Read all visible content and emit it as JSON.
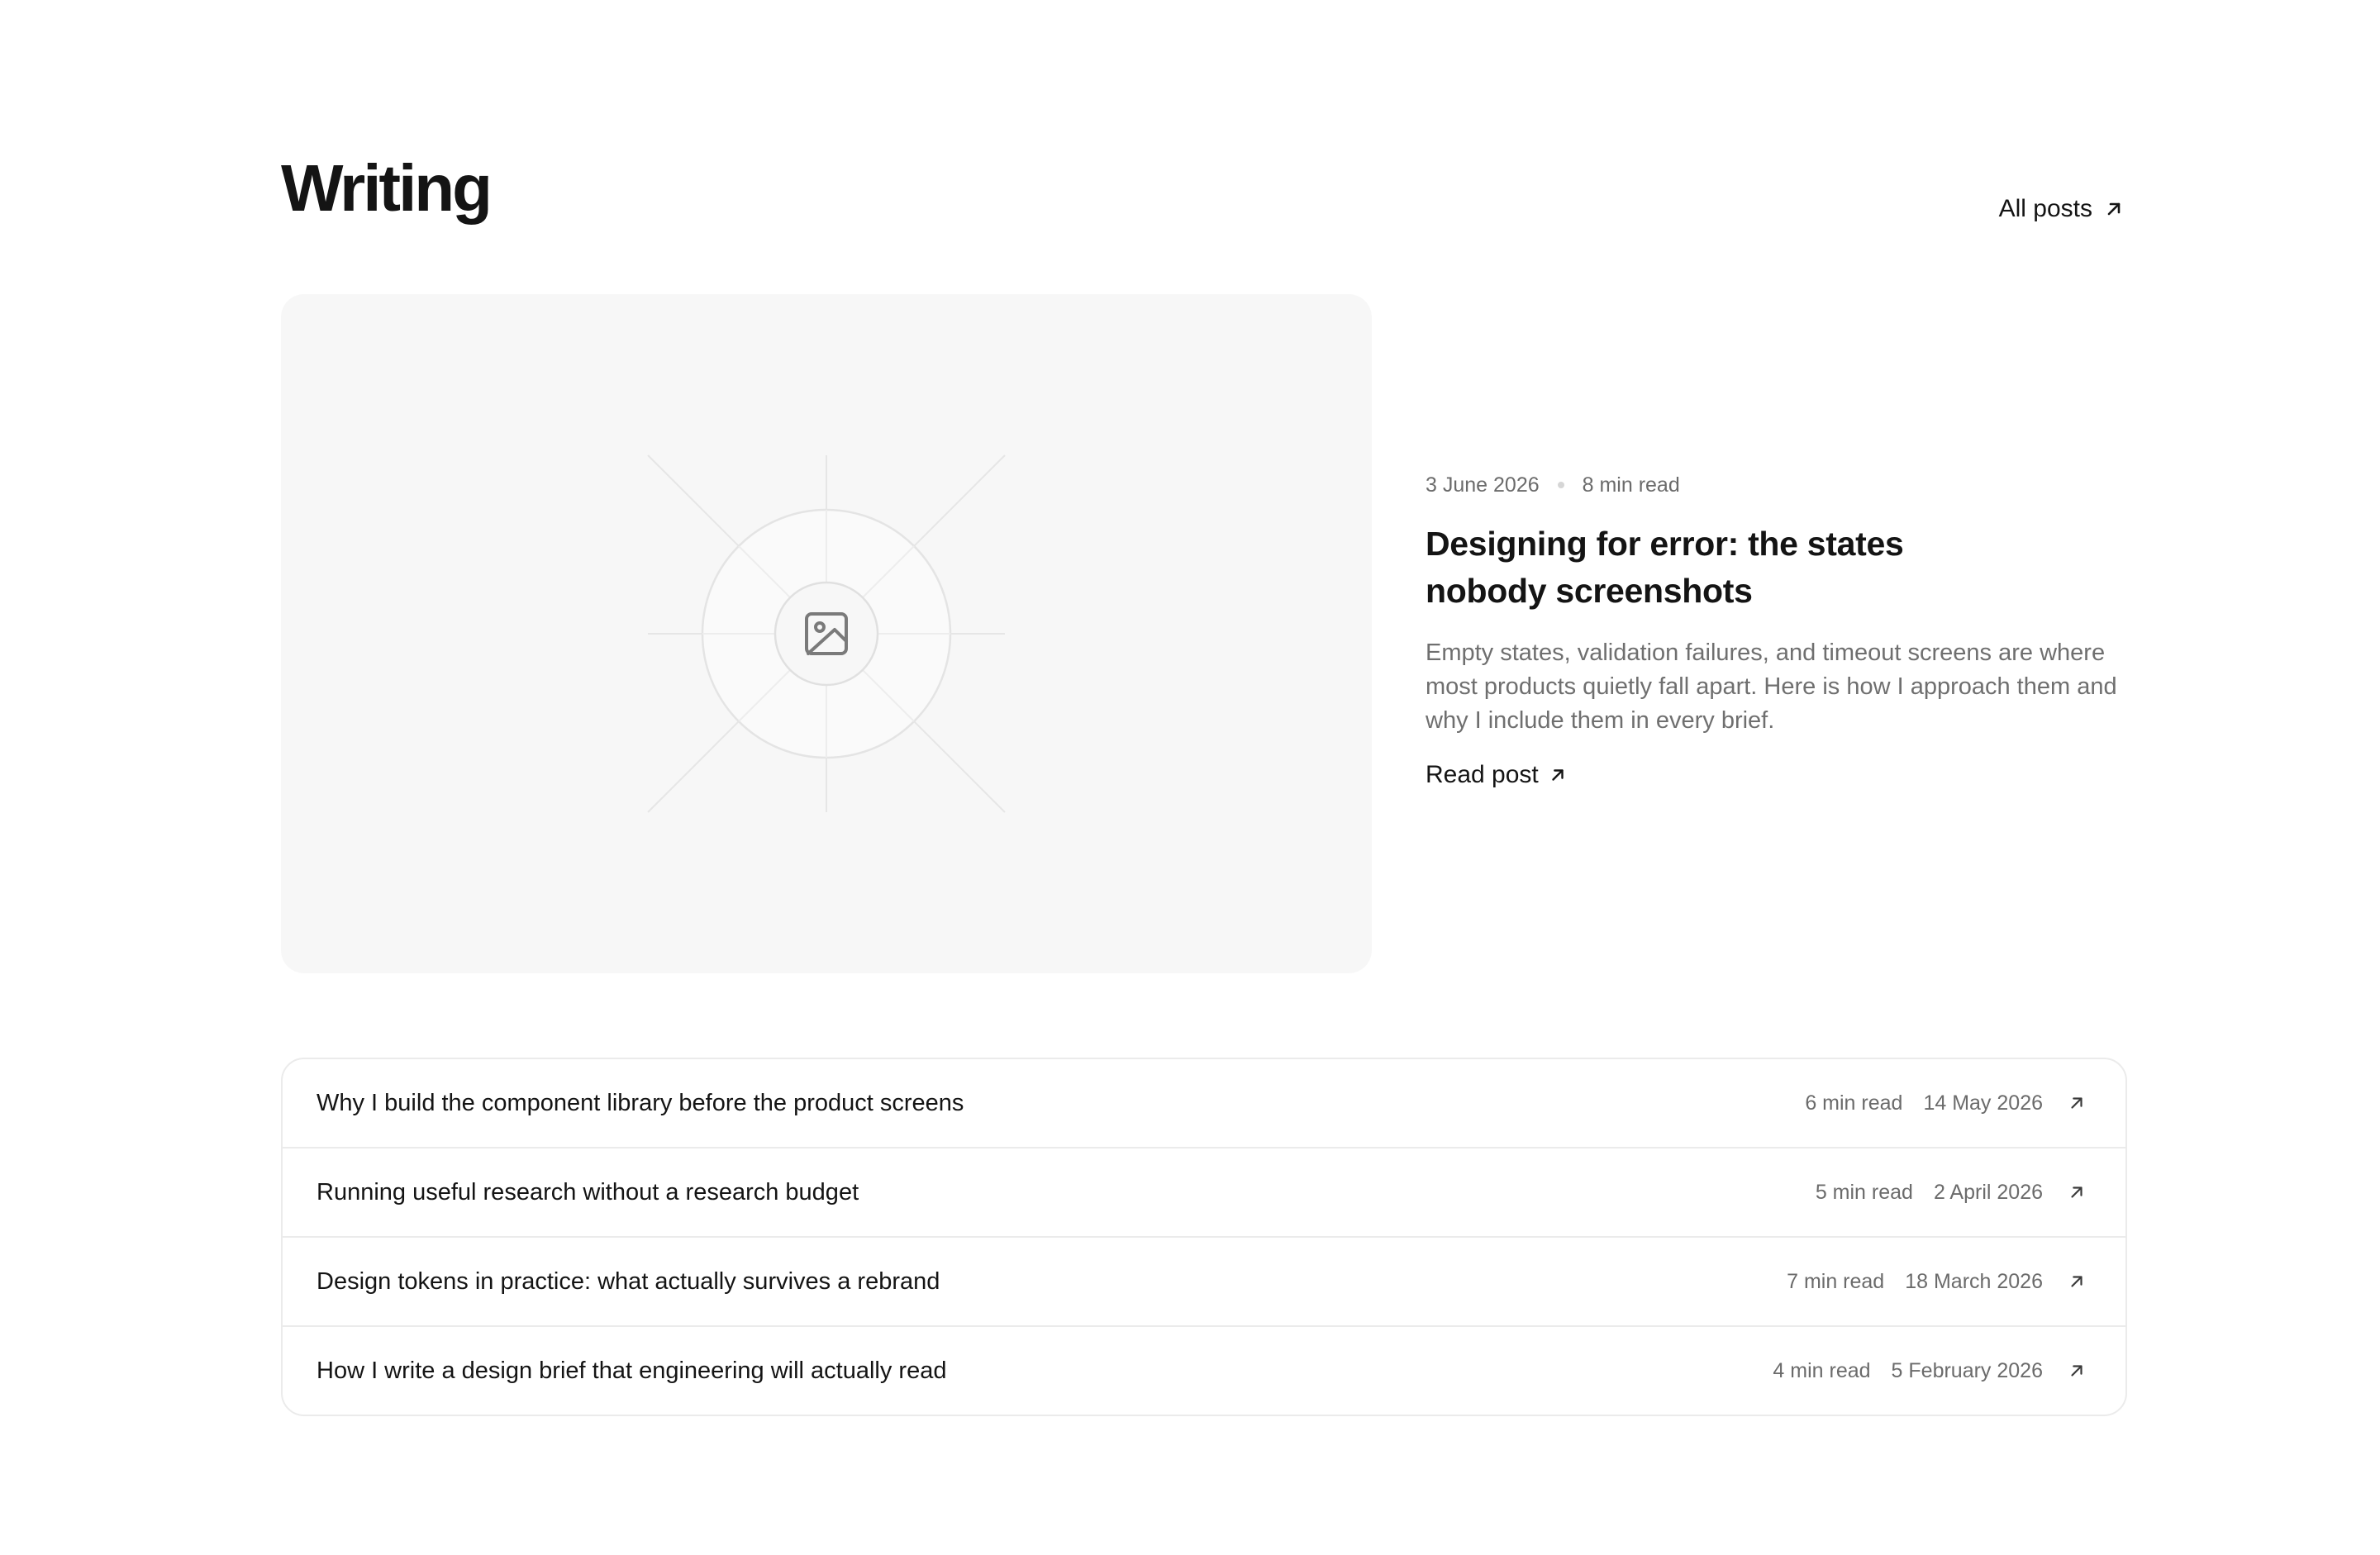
{
  "section": {
    "title": "Writing",
    "all_posts_label": "All posts"
  },
  "featured": {
    "date": "3 June 2026",
    "read_time": "8 min read",
    "title": "Designing for error: the states nobody screenshots",
    "excerpt": "Empty states, validation failures, and timeout screens are where most products quietly fall apart. Here is how I approach them and why I include them in every brief.",
    "cta_label": "Read post",
    "image_icon": "image-placeholder-icon"
  },
  "posts": [
    {
      "title": "Why I build the component library before the product screens",
      "read_time": "6 min read",
      "date": "14 May 2026"
    },
    {
      "title": "Running useful research without a research budget",
      "read_time": "5 min read",
      "date": "2 April 2026"
    },
    {
      "title": "Design tokens in practice: what actually survives a rebrand",
      "read_time": "7 min read",
      "date": "18 March 2026"
    },
    {
      "title": "How I write a design brief that engineering will actually read",
      "read_time": "4 min read",
      "date": "5 February 2026"
    }
  ],
  "icons": {
    "link_arrow": "arrow-up-right-icon"
  },
  "colors": {
    "text": "#141414",
    "muted": "#6b6b6b",
    "border": "#ebebeb",
    "media_bg": "#f7f7f7"
  }
}
